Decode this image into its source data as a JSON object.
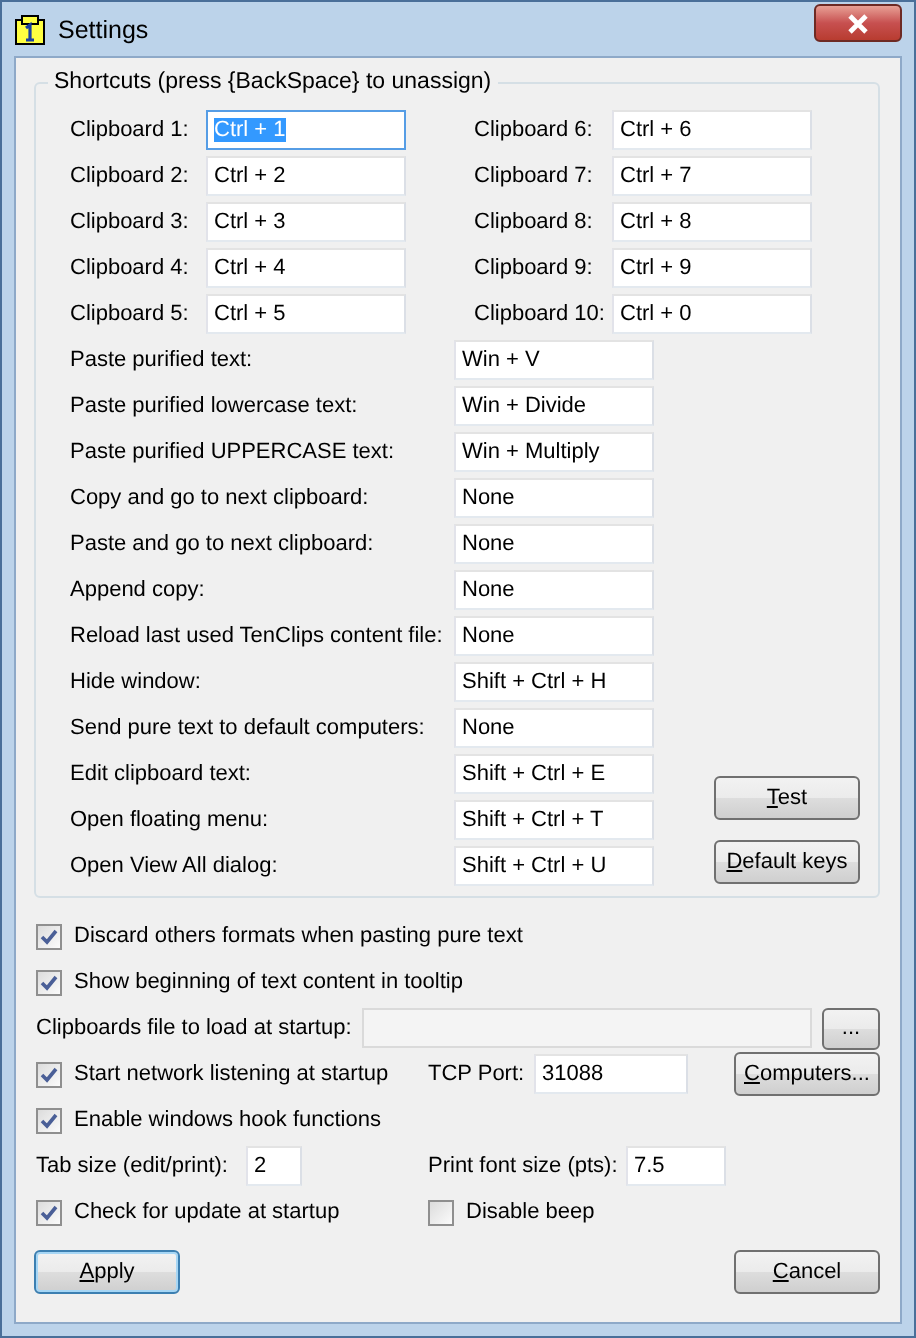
{
  "window": {
    "title": "Settings"
  },
  "shortcuts": {
    "title": "Shortcuts (press {BackSpace} to unassign)",
    "clipboards": [
      {
        "label": "Clipboard 1:",
        "value": "Ctrl + 1",
        "selected": true
      },
      {
        "label": "Clipboard 2:",
        "value": "Ctrl + 2",
        "selected": false
      },
      {
        "label": "Clipboard 3:",
        "value": "Ctrl + 3",
        "selected": false
      },
      {
        "label": "Clipboard 4:",
        "value": "Ctrl + 4",
        "selected": false
      },
      {
        "label": "Clipboard 5:",
        "value": "Ctrl + 5",
        "selected": false
      },
      {
        "label": "Clipboard 6:",
        "value": "Ctrl + 6",
        "selected": false
      },
      {
        "label": "Clipboard 7:",
        "value": "Ctrl + 7",
        "selected": false
      },
      {
        "label": "Clipboard 8:",
        "value": "Ctrl + 8",
        "selected": false
      },
      {
        "label": "Clipboard 9:",
        "value": "Ctrl + 9",
        "selected": false
      },
      {
        "label": "Clipboard 10:",
        "value": "Ctrl + 0",
        "selected": false
      }
    ],
    "actions": [
      {
        "label": "Paste purified text:",
        "value": "Win + V"
      },
      {
        "label": "Paste purified lowercase text:",
        "value": "Win + Divide"
      },
      {
        "label": "Paste purified UPPERCASE text:",
        "value": "Win + Multiply"
      },
      {
        "label": "Copy and go to next clipboard:",
        "value": "None"
      },
      {
        "label": "Paste and go to next clipboard:",
        "value": "None"
      },
      {
        "label": "Append copy:",
        "value": "None"
      },
      {
        "label": "Reload last used TenClips content file:",
        "value": "None"
      },
      {
        "label": "Hide window:",
        "value": "Shift + Ctrl + H"
      },
      {
        "label": "Send pure text to default computers:",
        "value": "None"
      },
      {
        "label": "Edit clipboard text:",
        "value": "Shift + Ctrl + E"
      },
      {
        "label": "Open floating menu:",
        "value": "Shift + Ctrl + T"
      },
      {
        "label": "Open View All dialog:",
        "value": "Shift + Ctrl + U"
      }
    ],
    "buttons": [
      {
        "label": "Test",
        "mnemonic": true
      },
      {
        "label": "Default keys",
        "mnemonic": true
      }
    ]
  },
  "discard_formats": {
    "label": "Discard others formats when pasting pure text",
    "checked": true
  },
  "show_tooltip": {
    "label": "Show beginning of text content in tooltip",
    "checked": true
  },
  "startup_file": {
    "label": "Clipboards file to load at startup:",
    "disabled": true,
    "browse": "..."
  },
  "network": {
    "label": "Start network listening at startup",
    "checked": true,
    "port_label": "TCP Port:",
    "port": "31088",
    "button": "Computers...",
    "mnemonic": true
  },
  "hooks": {
    "label": "Enable windows hook functions",
    "checked": true
  },
  "tab_size": {
    "label": "Tab size (edit/print):",
    "value": "2"
  },
  "print_font": {
    "label": "Print font size (pts):",
    "value": "7.5"
  },
  "check_update": {
    "label": "Check for update at startup",
    "checked": true
  },
  "disable_beep": {
    "label": "Disable beep",
    "checked": false
  },
  "footer": [
    {
      "label": "Apply",
      "default": true,
      "mnemonic": true
    },
    {
      "label": "Cancel",
      "default": false,
      "mnemonic": true
    }
  ]
}
